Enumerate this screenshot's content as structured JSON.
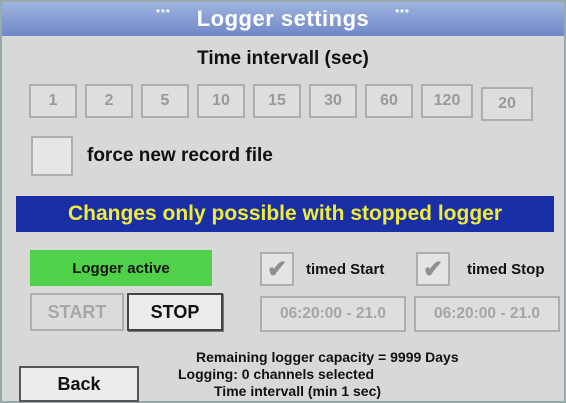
{
  "window": {
    "title": "Logger settings",
    "stars_left": "***",
    "stars_right": "***"
  },
  "interval": {
    "title": "Time intervall (sec)",
    "options": [
      "1",
      "2",
      "5",
      "10",
      "15",
      "30",
      "60",
      "120",
      "20"
    ]
  },
  "force_new_record": {
    "label": "force new record file"
  },
  "banner": {
    "text": "Changes only possible with stopped logger"
  },
  "logger_status": {
    "text": "Logger  active"
  },
  "controls": {
    "start_label": "START",
    "stop_label": "STOP",
    "back_label": "Back"
  },
  "timed_start": {
    "label": "timed Start",
    "value": "06:20:00 - 21.0",
    "check_glyph": "✔"
  },
  "timed_stop": {
    "label": "timed Stop",
    "value": "06:20:00 - 21.0",
    "check_glyph": "✔"
  },
  "info": {
    "capacity_label": "Remaining logger capacity = ",
    "capacity_value": "9999 Days",
    "channels": "Logging: 0 channels selected",
    "min_interval": "Time intervall (min 1 sec)"
  },
  "colors": {
    "title_bar": "#7f96d2",
    "banner_bg": "#1a2fa6",
    "banner_text": "#f0ec3a",
    "status_active": "#4fd14a"
  }
}
